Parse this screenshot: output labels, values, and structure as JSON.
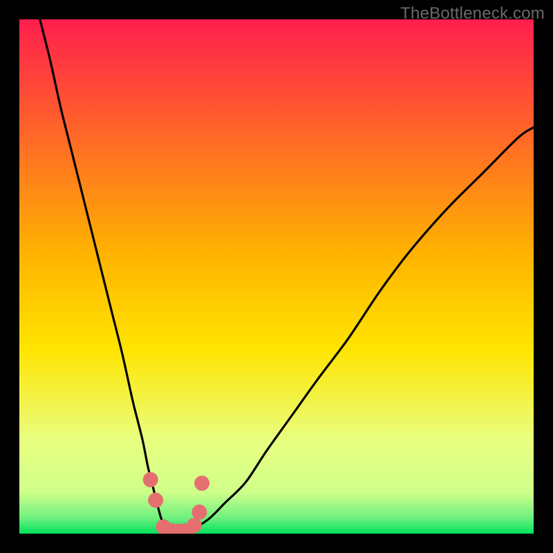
{
  "watermark": "TheBottleneck.com",
  "colors": {
    "frame": "#000000",
    "top": "#ff1e4e",
    "mid": "#ffe400",
    "low": "#e8ff80",
    "green": "#00e35a",
    "curve": "#000000",
    "dot": "#e56f6f"
  },
  "chart_data": {
    "type": "line",
    "title": "",
    "xlabel": "",
    "ylabel": "",
    "xlim": [
      0,
      100
    ],
    "ylim": [
      0,
      100
    ],
    "grid": false,
    "legend": false,
    "series": [
      {
        "name": "bottleneck-curve",
        "x": [
          4,
          6,
          8,
          10,
          12,
          14,
          16,
          18,
          20,
          22,
          23,
          24,
          25,
          26,
          27,
          28,
          30,
          32,
          34,
          37,
          40,
          44,
          48,
          53,
          58,
          64,
          70,
          76,
          83,
          90,
          97,
          100
        ],
        "values": [
          100,
          92,
          83,
          75,
          67,
          59,
          51,
          43,
          35,
          26,
          22,
          18,
          13,
          9,
          5,
          2,
          0,
          0,
          1,
          3,
          6,
          10,
          16,
          23,
          30,
          38,
          47,
          55,
          63,
          70,
          77,
          79
        ]
      }
    ],
    "optimal_points": {
      "name": "optimal-range-dots",
      "x": [
        25.5,
        26.5,
        28.0,
        29.5,
        31.0,
        32.5,
        34.0,
        35.0,
        35.5
      ],
      "values": [
        10.5,
        6.5,
        1.3,
        0.6,
        0.5,
        0.6,
        1.6,
        4.2,
        9.8
      ]
    },
    "annotations": []
  }
}
